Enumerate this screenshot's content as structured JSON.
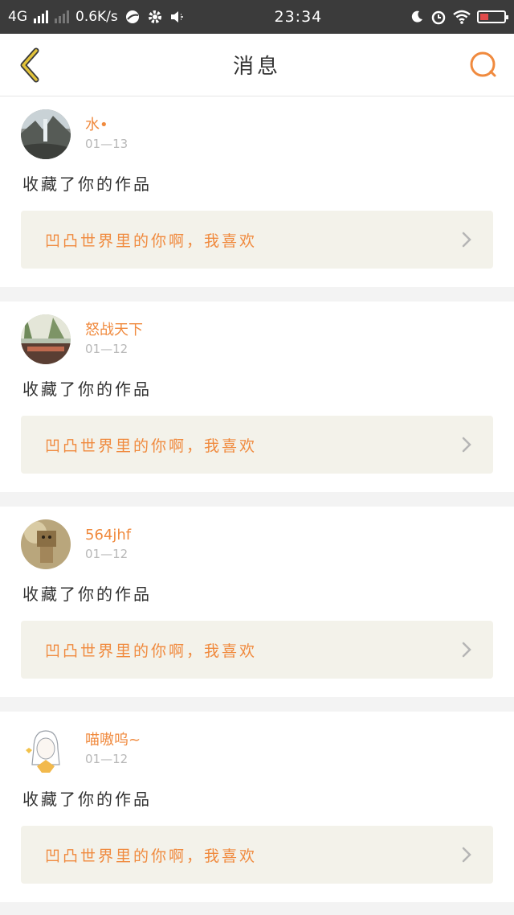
{
  "statusbar": {
    "network": "4G",
    "speed": "0.6K/s",
    "time": "23:34"
  },
  "header": {
    "title": "消息",
    "back_icon": "chevron-left-icon",
    "search_icon": "search-icon"
  },
  "colors": {
    "accent": "#f08a3e",
    "back_icon": "#e2c33a",
    "card_link_bg": "#f3f2ea"
  },
  "messages": [
    {
      "username": "水•",
      "date": "01—13",
      "action": "收藏了你的作品",
      "work_title": "凹凸世界里的你啊，我喜欢"
    },
    {
      "username": "怒战天下",
      "date": "01—12",
      "action": "收藏了你的作品",
      "work_title": "凹凸世界里的你啊，我喜欢"
    },
    {
      "username": "564jhf",
      "date": "01—12",
      "action": "收藏了你的作品",
      "work_title": "凹凸世界里的你啊，我喜欢"
    },
    {
      "username": "喵嗷呜~",
      "date": "01—12",
      "action": "收藏了你的作品",
      "work_title": "凹凸世界里的你啊，我喜欢"
    }
  ]
}
